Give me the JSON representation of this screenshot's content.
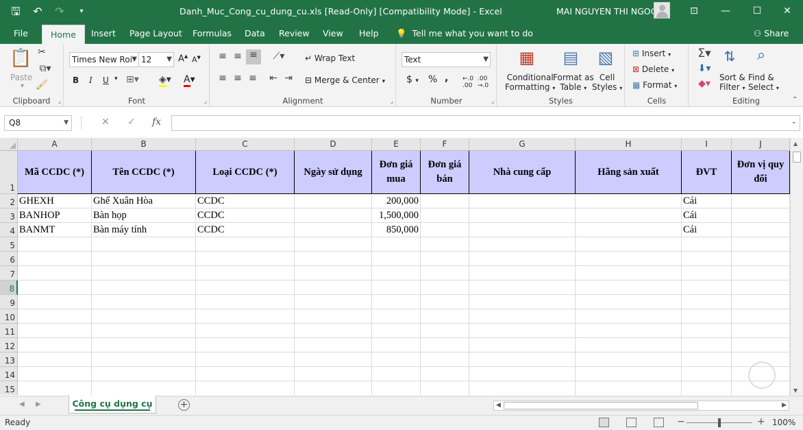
{
  "titlebar": {
    "filename": "Danh_Muc_Cong_cu_dung_cu.xls",
    "modes": "[Read-Only]  [Compatibility Mode]",
    "app": "Excel",
    "title_full": "Danh_Muc_Cong_cu_dung_cu.xls  [Read-Only]  [Compatibility Mode]  -  Excel",
    "user": "MAI NGUYEN THI NGOC"
  },
  "ribbon_tabs": [
    "File",
    "Home",
    "Insert",
    "Page Layout",
    "Formulas",
    "Data",
    "Review",
    "View",
    "Help"
  ],
  "active_tab": "Home",
  "tell_me": "Tell me what you want to do",
  "share": "Share",
  "ribbon": {
    "clipboard": {
      "paste": "Paste",
      "label": "Clipboard"
    },
    "font": {
      "name": "Times New Roi",
      "size": "12",
      "label": "Font",
      "bold": "B",
      "italic": "I",
      "underline": "U"
    },
    "alignment": {
      "wrap": "Wrap Text",
      "merge": "Merge & Center",
      "label": "Alignment"
    },
    "number": {
      "format": "Text",
      "currency": "$",
      "percent": "%",
      "comma": ",",
      "label": "Number"
    },
    "styles": {
      "conditional_1": "Conditional",
      "conditional_2": "Formatting",
      "format_table_1": "Format as",
      "format_table_2": "Table",
      "cell_styles_1": "Cell",
      "cell_styles_2": "Styles",
      "label": "Styles"
    },
    "cells": {
      "insert": "Insert",
      "delete": "Delete",
      "format": "Format",
      "label": "Cells"
    },
    "editing": {
      "sort_1": "Sort &",
      "sort_2": "Filter",
      "find_1": "Find &",
      "find_2": "Select",
      "label": "Editing"
    }
  },
  "name_box": "Q8",
  "formula_icons": {
    "cancel": "✕",
    "enter": "✓",
    "fx": "fx"
  },
  "columns": [
    "A",
    "B",
    "C",
    "D",
    "E",
    "F",
    "G",
    "H",
    "I",
    "J"
  ],
  "rows": [
    "1",
    "2",
    "3",
    "4",
    "5",
    "6",
    "7",
    "8",
    "9",
    "10",
    "11",
    "12",
    "13",
    "14",
    "15"
  ],
  "selected_row": "8",
  "header_row": [
    "Mã CCDC (*)",
    "Tên CCDC (*)",
    "Loại CCDC (*)",
    "Ngày sử dụng",
    "Đơn giá mua",
    "Đơn giá bán",
    "Nhà cung cấp",
    "Hãng sản xuất",
    "ĐVT",
    "Đơn vị quy đổi"
  ],
  "data_rows": [
    {
      "ma": "GHEXH",
      "ten": "Ghế Xuân Hòa",
      "loai": "CCDC",
      "ngay": "",
      "gia_mua": "200,000",
      "gia_ban": "",
      "ncc": "",
      "hang": "",
      "dvt": "Cái",
      "quydoi": ""
    },
    {
      "ma": "BANHOP",
      "ten": "Bàn họp",
      "loai": "CCDC",
      "ngay": "",
      "gia_mua": "1,500,000",
      "gia_ban": "",
      "ncc": "",
      "hang": "",
      "dvt": "Cái",
      "quydoi": ""
    },
    {
      "ma": "BANMT",
      "ten": "Bàn máy tính",
      "loai": "CCDC",
      "ngay": "",
      "gia_mua": "850,000",
      "gia_ban": "",
      "ncc": "",
      "hang": "",
      "dvt": "Cái",
      "quydoi": ""
    }
  ],
  "sheet_tab": "Công cụ dụng cụ",
  "status": {
    "ready": "Ready",
    "zoom": "100%"
  },
  "colors": {
    "excel_green": "#217346",
    "header_fill": "#ccccff"
  }
}
